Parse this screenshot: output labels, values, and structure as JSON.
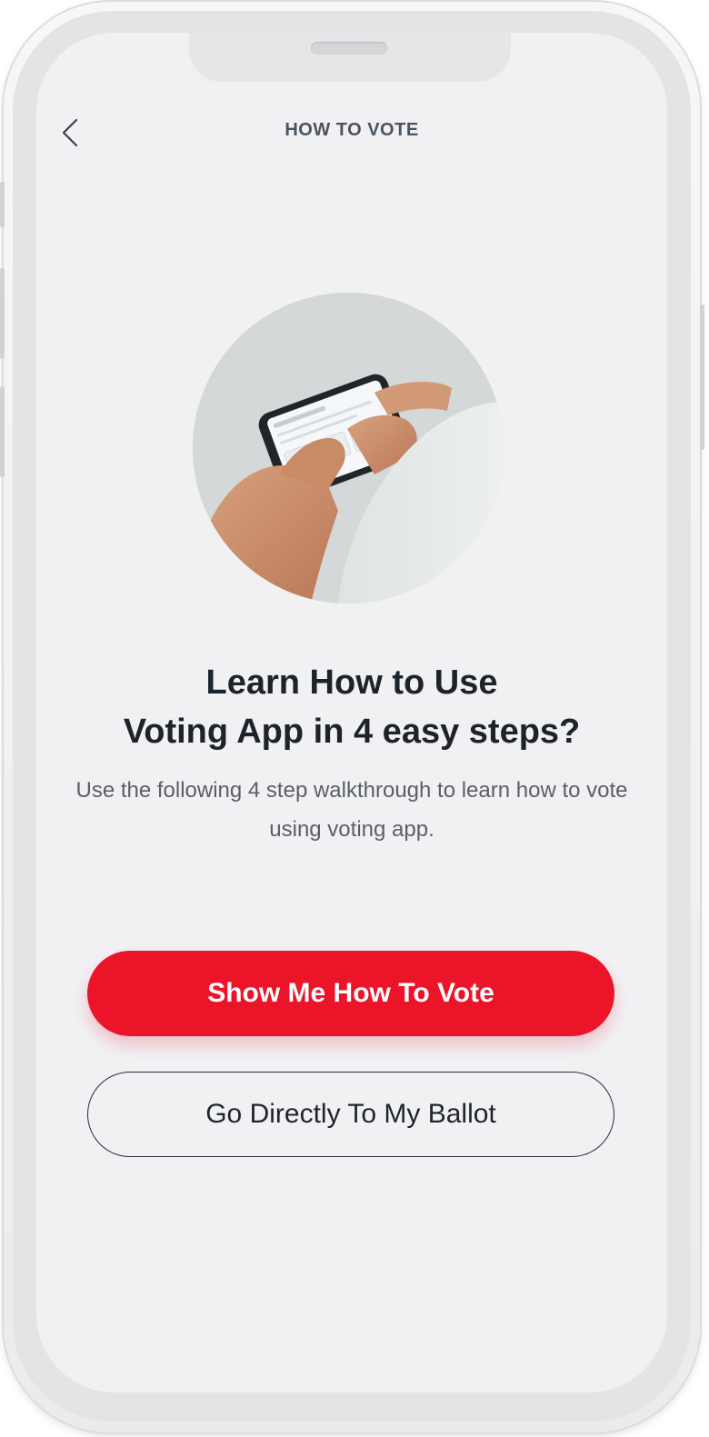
{
  "header": {
    "title": "HOW TO VOTE",
    "back_icon": "chevron-left-icon"
  },
  "hero": {
    "image_description_icon": "hand-holding-phone-illustration"
  },
  "content": {
    "headline_line1": "Learn How to Use",
    "headline_line2": "Voting App in 4 easy steps?",
    "subtext": "Use the following 4 step walkthrough to learn how to vote using voting app."
  },
  "actions": {
    "primary_label": "Show Me How To Vote",
    "secondary_label": "Go Directly To My Ballot"
  },
  "colors": {
    "accent": "#eb1429",
    "screen_background": "#f1f1f4",
    "title_text": "#4a5560",
    "headline_text": "#1c232b"
  }
}
